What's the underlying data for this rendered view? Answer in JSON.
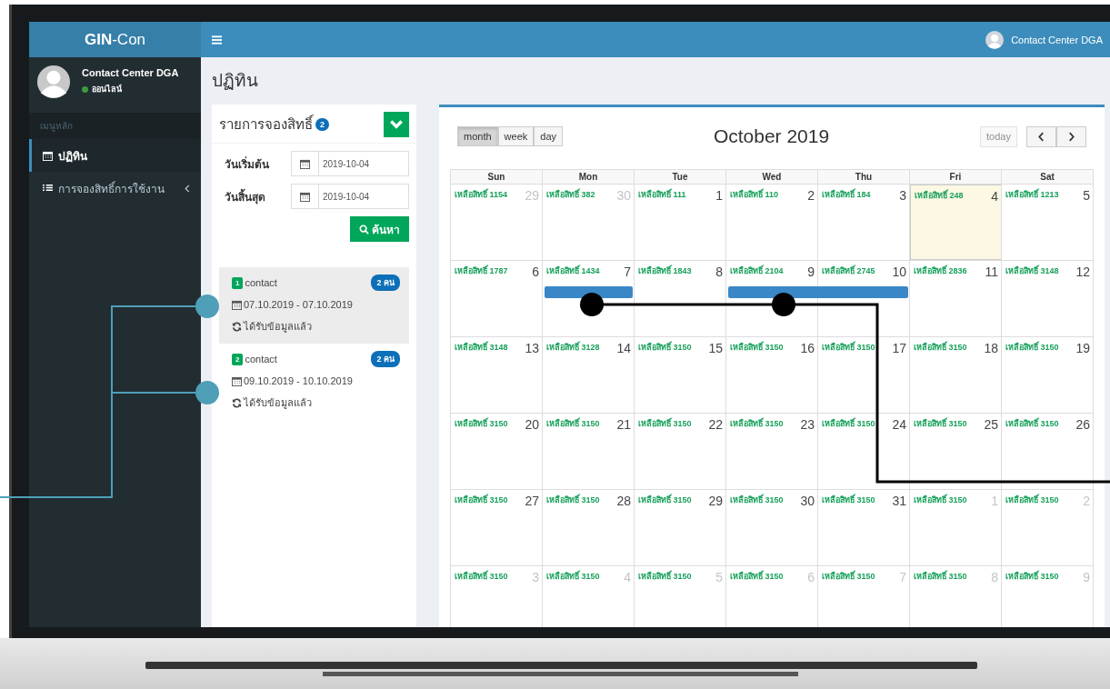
{
  "brand": "**GIN**-Con",
  "topbar": {
    "user": "Contact Center DGA"
  },
  "sidebar": {
    "user": "Contact Center DGA",
    "status": "ออนไลน์",
    "online": true,
    "section": "เมนูหลัก",
    "items": [
      {
        "label": "ปฏิทิน",
        "kind": "calendar",
        "selected": true,
        "expandable": false
      },
      {
        "label": "การจองสิทธิ์การใช้งาน",
        "kind": "list",
        "selected": false,
        "expandable": true
      }
    ]
  },
  "page_title": "ปฏิทิน",
  "bookings_panel": {
    "title": "รายการจองสิทธิ์",
    "count": "2",
    "fields": [
      {
        "label": "วันเริ่มต้น",
        "value": "2019-10-04"
      },
      {
        "label": "วันสิ้นสุด",
        "value": "2019-10-04"
      }
    ],
    "search_button": "ค้นหา",
    "bookings": [
      {
        "number": "1",
        "name": "contact",
        "people": "2 คน",
        "dates": "07.10.2019 - 07.10.2019",
        "status": "ได้รับข้อมูลแล้ว",
        "selected": true
      },
      {
        "number": "2",
        "name": "contact",
        "people": "2 คน",
        "dates": "09.10.2019 - 10.10.2019",
        "status": "ได้รับข้อมูลแล้ว",
        "selected": false
      }
    ]
  },
  "calendar": {
    "views": [
      {
        "label": "month",
        "selected": true
      },
      {
        "label": "week",
        "selected": false
      },
      {
        "label": "day",
        "selected": false
      }
    ],
    "title": "October 2019",
    "today_button": {
      "label": "today",
      "disabled": true
    },
    "weekdays": [
      "Sun",
      "Mon",
      "Tue",
      "Wed",
      "Thu",
      "Fri",
      "Sat"
    ],
    "weeks": [
      {
        "days": [
          {
            "text": "เหลือสิทธิ์ 1154",
            "number": "29",
            "outside": true,
            "today": false
          },
          {
            "text": "เหลือสิทธิ์ 382",
            "number": "30",
            "outside": true,
            "today": false
          },
          {
            "text": "เหลือสิทธิ์ 111",
            "number": "1",
            "outside": false,
            "today": false
          },
          {
            "text": "เหลือสิทธิ์ 110",
            "number": "2",
            "outside": false,
            "today": false
          },
          {
            "text": "เหลือสิทธิ์ 184",
            "number": "3",
            "outside": false,
            "today": false
          },
          {
            "text": "เหลือสิทธิ์ 248",
            "number": "4",
            "outside": false,
            "today": true
          },
          {
            "text": "เหลือสิทธิ์ 1213",
            "number": "5",
            "outside": false,
            "today": false
          }
        ]
      },
      {
        "days": [
          {
            "text": "เหลือสิทธิ์ 1787",
            "number": "6",
            "outside": false,
            "today": false
          },
          {
            "text": "เหลือสิทธิ์ 1434",
            "number": "7",
            "outside": false,
            "today": false,
            "event": true,
            "joins_next": false
          },
          {
            "text": "เหลือสิทธิ์ 1843",
            "number": "8",
            "outside": false,
            "today": false
          },
          {
            "text": "เหลือสิทธิ์ 2104",
            "number": "9",
            "outside": false,
            "today": false,
            "event": true,
            "joins_next": true
          },
          {
            "text": "เหลือสิทธิ์ 2745",
            "number": "10",
            "outside": false,
            "today": false,
            "event": true,
            "joins_next": false
          },
          {
            "text": "เหลือสิทธิ์ 2836",
            "number": "11",
            "outside": false,
            "today": false
          },
          {
            "text": "เหลือสิทธิ์ 3148",
            "number": "12",
            "outside": false,
            "today": false
          }
        ]
      },
      {
        "days": [
          {
            "text": "เหลือสิทธิ์ 3148",
            "number": "13",
            "outside": false,
            "today": false
          },
          {
            "text": "เหลือสิทธิ์ 3128",
            "number": "14",
            "outside": false,
            "today": false
          },
          {
            "text": "เหลือสิทธิ์ 3150",
            "number": "15",
            "outside": false,
            "today": false
          },
          {
            "text": "เหลือสิทธิ์ 3150",
            "number": "16",
            "outside": false,
            "today": false
          },
          {
            "text": "เหลือสิทธิ์ 3150",
            "number": "17",
            "outside": false,
            "today": false
          },
          {
            "text": "เหลือสิทธิ์ 3150",
            "number": "18",
            "outside": false,
            "today": false
          },
          {
            "text": "เหลือสิทธิ์ 3150",
            "number": "19",
            "outside": false,
            "today": false
          }
        ]
      },
      {
        "days": [
          {
            "text": "เหลือสิทธิ์ 3150",
            "number": "20",
            "outside": false,
            "today": false
          },
          {
            "text": "เหลือสิทธิ์ 3150",
            "number": "21",
            "outside": false,
            "today": false
          },
          {
            "text": "เหลือสิทธิ์ 3150",
            "number": "22",
            "outside": false,
            "today": false
          },
          {
            "text": "เหลือสิทธิ์ 3150",
            "number": "23",
            "outside": false,
            "today": false
          },
          {
            "text": "เหลือสิทธิ์ 3150",
            "number": "24",
            "outside": false,
            "today": false
          },
          {
            "text": "เหลือสิทธิ์ 3150",
            "number": "25",
            "outside": false,
            "today": false
          },
          {
            "text": "เหลือสิทธิ์ 3150",
            "number": "26",
            "outside": false,
            "today": false
          }
        ]
      },
      {
        "days": [
          {
            "text": "เหลือสิทธิ์ 3150",
            "number": "27",
            "outside": false,
            "today": false
          },
          {
            "text": "เหลือสิทธิ์ 3150",
            "number": "28",
            "outside": false,
            "today": false
          },
          {
            "text": "เหลือสิทธิ์ 3150",
            "number": "29",
            "outside": false,
            "today": false
          },
          {
            "text": "เหลือสิทธิ์ 3150",
            "number": "30",
            "outside": false,
            "today": false
          },
          {
            "text": "เหลือสิทธิ์ 3150",
            "number": "31",
            "outside": false,
            "today": false
          },
          {
            "text": "เหลือสิทธิ์ 3150",
            "number": "1",
            "outside": true,
            "today": false
          },
          {
            "text": "เหลือสิทธิ์ 3150",
            "number": "2",
            "outside": true,
            "today": false
          }
        ]
      },
      {
        "days": [
          {
            "text": "เหลือสิทธิ์ 3150",
            "number": "3",
            "outside": true,
            "today": false
          },
          {
            "text": "เหลือสิทธิ์ 3150",
            "number": "4",
            "outside": true,
            "today": false
          },
          {
            "text": "เหลือสิทธิ์ 3150",
            "number": "5",
            "outside": true,
            "today": false
          },
          {
            "text": "เหลือสิทธิ์ 3150",
            "number": "6",
            "outside": true,
            "today": false
          },
          {
            "text": "เหลือสิทธิ์ 3150",
            "number": "7",
            "outside": true,
            "today": false
          },
          {
            "text": "เหลือสิทธิ์ 3150",
            "number": "8",
            "outside": true,
            "today": false
          },
          {
            "text": "เหลือสิทธิ์ 3150",
            "number": "9",
            "outside": true,
            "today": false
          }
        ]
      }
    ]
  }
}
